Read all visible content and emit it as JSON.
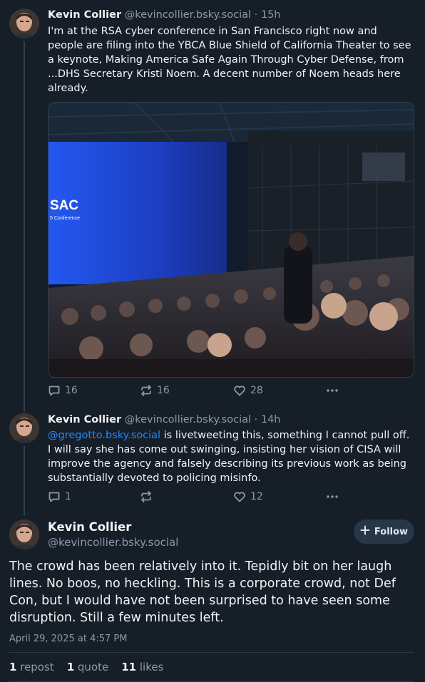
{
  "posts": [
    {
      "author": "Kevin Collier",
      "handle": "@kevincollier.bsky.social",
      "separator": "·",
      "time": "15h",
      "text": "I'm at the RSA cyber conference in San Francisco right now and people are filing into the YBCA Blue Shield of California Theater to see a keynote, Making America Safe Again Through Cyber Defense, from ...DHS Secretary Kristi Noem. A decent number of Noem heads here already.",
      "image_screen_text": "SAC",
      "image_screen_subtext": "5 Conference",
      "replies": "16",
      "reposts": "16",
      "likes": "28"
    },
    {
      "author": "Kevin Collier",
      "handle": "@kevincollier.bsky.social",
      "separator": "·",
      "time": "14h",
      "mention": "@gregotto.bsky.social",
      "text": " is livetweeting this, something I cannot pull off. I will say she has come out swinging, insisting her vision of CISA will improve the agency and falsely describing its previous work as being substantially devoted to policing misinfo.",
      "replies": "1",
      "reposts": "",
      "likes": "12"
    }
  ],
  "main_post": {
    "author": "Kevin Collier",
    "handle": "@kevincollier.bsky.social",
    "follow_label": "Follow",
    "text": "The crowd has been relatively into it. Tepidly bit on her laugh lines. No boos, no heckling. This is a corporate crowd, not Def Con, but I would have not been surprised to have seen some disruption. Still a few minutes left.",
    "timestamp": "April 29, 2025 at 4:57 PM",
    "reposts_count": "1",
    "reposts_label": "repost",
    "quotes_count": "1",
    "quotes_label": "quote",
    "likes_count": "11",
    "likes_label": "likes"
  },
  "colors": {
    "background": "#161e27",
    "text": "#f1f3f5",
    "muted": "#8d9aa8",
    "link": "#208bfe",
    "stage_blue": "#1f4fe0"
  },
  "icons": [
    "reply-icon",
    "repost-icon",
    "like-icon",
    "more-icon",
    "plus-icon"
  ]
}
